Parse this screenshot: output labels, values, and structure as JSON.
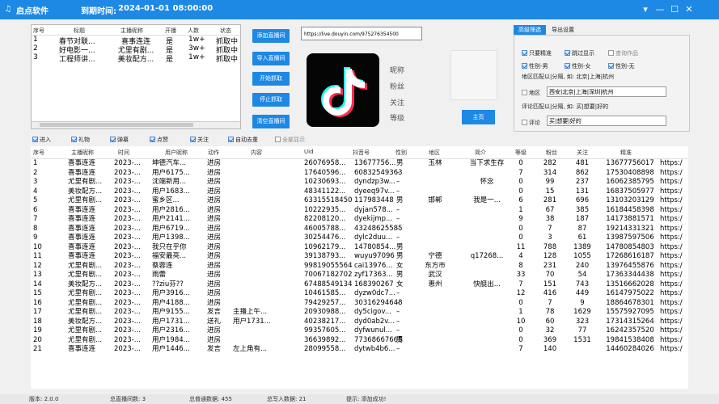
{
  "window": {
    "app_name": "启点软件",
    "expire_label": "到期时间:",
    "expire_value": "2024-01-01 08:00:00",
    "buttons": {
      "menu": "▾",
      "minimize": "—",
      "maximize": "☐",
      "close": "✕"
    }
  },
  "room_list": {
    "headers": [
      "序号",
      "标题",
      "主播昵称",
      "开播",
      "人数",
      "状态"
    ],
    "rows": [
      [
        "1",
        "春节对联...",
        "喜事连连",
        "是",
        "1w+",
        "抓取中"
      ],
      [
        "2",
        "好电影一...",
        "尤里有剧...",
        "是",
        "3w+",
        "抓取中"
      ],
      [
        "3",
        "工程师讲...",
        "美妆配方...",
        "是",
        "1w+",
        "抓取中"
      ]
    ]
  },
  "actions": [
    "添加直播间",
    "导入直播间",
    "开始抓取",
    "停止抓取",
    "清空直播间"
  ],
  "url_input": "https://live.douyin.com/975276354500",
  "profile": {
    "labels": [
      "昵称",
      "粉丝",
      "关注",
      "等级"
    ],
    "home_button": "主页"
  },
  "filter_panel": {
    "tabs": [
      "高级筛选",
      "导出设置"
    ],
    "checks": [
      {
        "label": "只要精准",
        "checked": true
      },
      {
        "label": "跳过显示",
        "checked": true
      },
      {
        "label": "查询作品",
        "checked": false
      },
      {
        "label": "性别-男",
        "checked": true
      },
      {
        "label": "性别-女",
        "checked": true
      },
      {
        "label": "性别-无",
        "checked": true
      }
    ],
    "region_hint": "地区匹配以|分隔, 如: 北京|上海|杭州",
    "region_label": "地区",
    "region_value": "西安|北京|上海|深圳|杭州",
    "comment_hint": "评论匹配以|分隔, 如: 买|想要|好的",
    "comment_label": "评论",
    "comment_value": "买|想要|好的"
  },
  "event_filters": [
    {
      "label": "进入",
      "checked": true
    },
    {
      "label": "礼物",
      "checked": true
    },
    {
      "label": "弹幕",
      "checked": true
    },
    {
      "label": "点赞",
      "checked": true
    },
    {
      "label": "关注",
      "checked": true
    },
    {
      "label": "自动去重",
      "checked": true
    },
    {
      "label": "全部显示",
      "checked": false
    }
  ],
  "table": {
    "headers": [
      "序号",
      "主播昵称",
      "时间",
      "用户昵称",
      "动作",
      "内容",
      "Uid",
      "抖音号",
      "性别",
      "地区",
      "简介",
      "等级",
      "粉丝",
      "关注",
      "精准"
    ],
    "rows": [
      [
        "1",
        "喜事连连",
        "2023-...",
        "坤德汽车...",
        "进房",
        "",
        "26076958...",
        "13677756...",
        "男",
        "玉林",
        "当下求生存",
        "0",
        "282",
        "481",
        "13677756017",
        "https:/"
      ],
      [
        "2",
        "喜事连连",
        "2023-...",
        "用户6175...",
        "进房",
        "",
        "17640596...",
        "60832549363",
        "–",
        "",
        "",
        "7",
        "314",
        "862",
        "17530408898",
        "https:/"
      ],
      [
        "3",
        "尤里有剧...",
        "2023-...",
        "沈端新用...",
        "进房",
        "",
        "10230693...",
        "dyndzp3w...",
        "–",
        "",
        "怀念",
        "0",
        "99",
        "237",
        "16062385795",
        "https:/"
      ],
      [
        "4",
        "美妆配方...",
        "2023-...",
        "用户1683...",
        "进房",
        "",
        "48341122...",
        "dyeeq97v...",
        "–",
        "",
        "",
        "0",
        "15",
        "131",
        "16837505977",
        "https:/"
      ],
      [
        "5",
        "尤里有剧...",
        "2023-...",
        "蜜乡区...",
        "进房",
        "",
        "63315518450",
        "117983448",
        "男",
        "邯郸",
        "我是一...",
        "6",
        "281",
        "696",
        "13103203129",
        "https:/"
      ],
      [
        "6",
        "喜事连连",
        "2023-...",
        "用户2816...",
        "进房",
        "",
        "10222935...",
        "dyjan578...",
        "–",
        "",
        "",
        "1",
        "67",
        "385",
        "16184458398",
        "https:/"
      ],
      [
        "7",
        "喜事连连",
        "2023-...",
        "用户2141...",
        "进房",
        "",
        "82208120...",
        "dyekijmp...",
        "–",
        "",
        "",
        "9",
        "38",
        "187",
        "14173881571",
        "https:/"
      ],
      [
        "8",
        "喜事连连",
        "2023-...",
        "用户6719...",
        "进房",
        "",
        "46005788...",
        "43248625585",
        "–",
        "",
        "",
        "0",
        "7",
        "87",
        "19214331321",
        "https:/"
      ],
      [
        "9",
        "喜事连连",
        "2023-...",
        "用户1398...",
        "进房",
        "",
        "30254476...",
        "dylc2duu...",
        "–",
        "",
        "",
        "0",
        "3",
        "61",
        "13987597506",
        "https:/"
      ],
      [
        "10",
        "喜事连连",
        "2023-...",
        "我只在乎你",
        "进房",
        "",
        "10962179...",
        "14780854...",
        "男",
        "",
        "",
        "11",
        "788",
        "1389",
        "14780854803",
        "https:/"
      ],
      [
        "11",
        "喜事连连",
        "2023-...",
        "福安最亮...",
        "进房",
        "",
        "39138793...",
        "wuyu97096",
        "男",
        "宁德",
        "q17268...",
        "4",
        "128",
        "1055",
        "17268616187",
        "https:/"
      ],
      [
        "12",
        "尤里有剧...",
        "2023-...",
        "蔡蓉连",
        "进房",
        "",
        "99819055564",
        "cai13976...",
        "女",
        "东方市",
        "",
        "8",
        "231",
        "240",
        "13976455876",
        "https:/"
      ],
      [
        "13",
        "尤里有剧...",
        "2023-...",
        "雨蕾",
        "进房",
        "",
        "70067182702",
        "zyf17363...",
        "男",
        "武汉",
        "",
        "33",
        "70",
        "54",
        "17363344438",
        "https:/"
      ],
      [
        "14",
        "美妆配方...",
        "2023-...",
        "??ziu芬??",
        "进房",
        "",
        "67488549134",
        "168390267",
        "女",
        "惠州",
        "快艇出...",
        "7",
        "151",
        "743",
        "13516662028",
        "https:/"
      ],
      [
        "15",
        "尤里有剧...",
        "2023-...",
        "用户3916...",
        "进房",
        "",
        "10461585...",
        "dyzw0dc7...",
        "–",
        "",
        "",
        "12",
        "416",
        "449",
        "16147975022",
        "https:/"
      ],
      [
        "16",
        "尤里有剧...",
        "2023-...",
        "用户4188...",
        "进房",
        "",
        "79429257...",
        "30316294648",
        "–",
        "",
        "",
        "0",
        "7",
        "9",
        "18864678301",
        "https:/"
      ],
      [
        "17",
        "尤里有剧...",
        "2023-...",
        "用户9155...",
        "发言",
        "主播上午...",
        "20930988...",
        "dy5cigov...",
        "–",
        "",
        "",
        "1",
        "78",
        "1629",
        "15575927095",
        "https:/"
      ],
      [
        "18",
        "美妆配方...",
        "2023-...",
        "用户1731...",
        "送礼",
        "用户1731...",
        "40238217...",
        "dyd0ab2v...",
        "–",
        "",
        "",
        "10",
        "60",
        "323",
        "17314315264",
        "https:/"
      ],
      [
        "19",
        "尤里有剧...",
        "2023-...",
        "用户2316...",
        "进房",
        "",
        "99357605...",
        "dyfwunul...",
        "–",
        "",
        "",
        "0",
        "32",
        "77",
        "16242357520",
        "https:/"
      ],
      [
        "20",
        "尤里有剧...",
        "2023-...",
        "用户1984...",
        "进房",
        "",
        "36639892...",
        "77368667665",
        "男",
        "",
        "",
        "0",
        "369",
        "1531",
        "19841538408",
        "https:/"
      ],
      [
        "21",
        "喜事连连",
        "2023-...",
        "用户1446...",
        "发言",
        "左上角有...",
        "28099558...",
        "dytwb4b6...",
        "–",
        "",
        "",
        "7",
        "140",
        "",
        "14460284026",
        "https:/"
      ]
    ]
  },
  "status_bar": {
    "version": "版本: 2.0.0",
    "total_rooms": "总直播间数: 3",
    "total_comments": "总普通数据: 455",
    "total_users": "总写入数据: 21",
    "tip": "提示: 添加成功!"
  }
}
